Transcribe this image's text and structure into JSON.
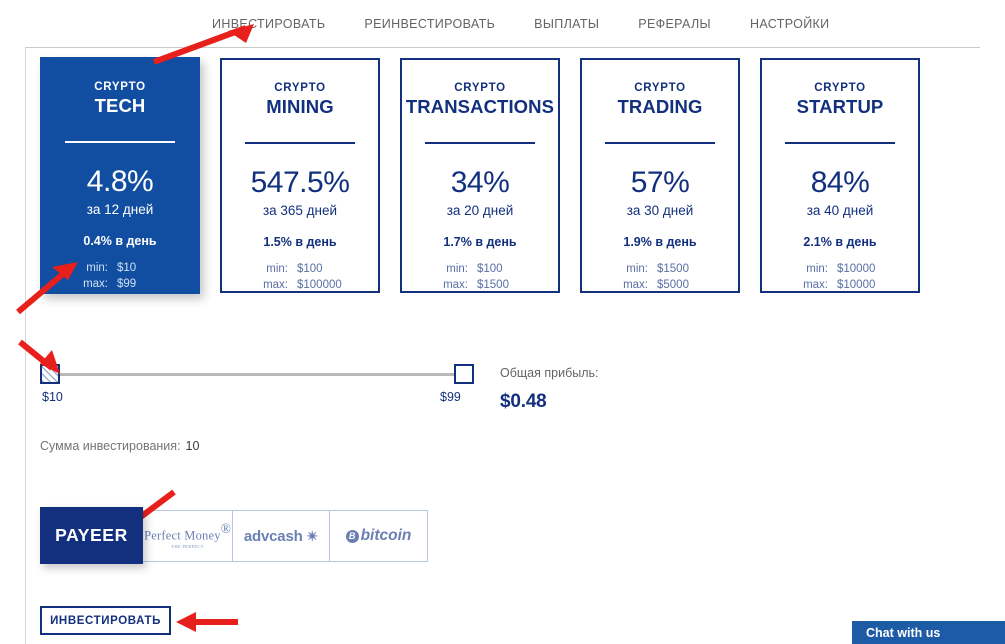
{
  "nav": {
    "items": [
      {
        "label": "ИНВЕСТИРОВАТЬ"
      },
      {
        "label": "РЕИНВЕСТИРОВАТЬ"
      },
      {
        "label": "ВЫПЛАТЫ"
      },
      {
        "label": "РЕФЕРАЛЫ"
      },
      {
        "label": "НАСТРОЙКИ"
      }
    ]
  },
  "plans": [
    {
      "brand": "CRYPTO",
      "name": "TECH",
      "percent": "4.8%",
      "term": "за 12 дней",
      "daily": "0.4% в день",
      "min_label": "min:",
      "min_value": "$10",
      "max_label": "max:",
      "max_value": "$99",
      "selected": true
    },
    {
      "brand": "CRYPTO",
      "name": "MINING",
      "percent": "547.5%",
      "term": "за 365 дней",
      "daily": "1.5% в день",
      "min_label": "min:",
      "min_value": "$100",
      "max_label": "max:",
      "max_value": "$100000",
      "selected": false
    },
    {
      "brand": "CRYPTO",
      "name": "TRANSACTIONS",
      "percent": "34%",
      "term": "за 20 дней",
      "daily": "1.7% в день",
      "min_label": "min:",
      "min_value": "$100",
      "max_label": "max:",
      "max_value": "$1500",
      "selected": false
    },
    {
      "brand": "CRYPTO",
      "name": "TRADING",
      "percent": "57%",
      "term": "за 30 дней",
      "daily": "1.9% в день",
      "min_label": "min:",
      "min_value": "$1500",
      "max_label": "max:",
      "max_value": "$5000",
      "selected": false
    },
    {
      "brand": "CRYPTO",
      "name": "STARTUP",
      "percent": "84%",
      "term": "за 40 дней",
      "daily": "2.1% в день",
      "min_label": "min:",
      "min_value": "$10000",
      "max_label": "max:",
      "max_value": "$10000",
      "selected": false
    }
  ],
  "slider": {
    "min_label": "$10",
    "max_label": "$99",
    "min_value": 10,
    "max_value": 99,
    "current": 10
  },
  "profit": {
    "label": "Общая прибыль:",
    "value": "$0.48"
  },
  "amount": {
    "label": "Сумма инвестирования:",
    "value": "10"
  },
  "payment_methods": [
    {
      "id": "payeer",
      "label": "PAYEER",
      "selected": true
    },
    {
      "id": "perfect-money",
      "label": "Perfect Money",
      "tagline": "THE PERFECT",
      "selected": false
    },
    {
      "id": "advcash",
      "label": "advcash",
      "selected": false
    },
    {
      "id": "bitcoin",
      "label": "bitcoin",
      "selected": false
    }
  ],
  "invest_button": {
    "label": "ИНВЕСТИРОВАТЬ"
  },
  "chat_widget": {
    "label": "Chat with us"
  },
  "colors": {
    "brand_dark": "#13307f",
    "brand_selected": "#114ea1",
    "accent_red": "#e8201c",
    "muted_text": "#646464"
  }
}
